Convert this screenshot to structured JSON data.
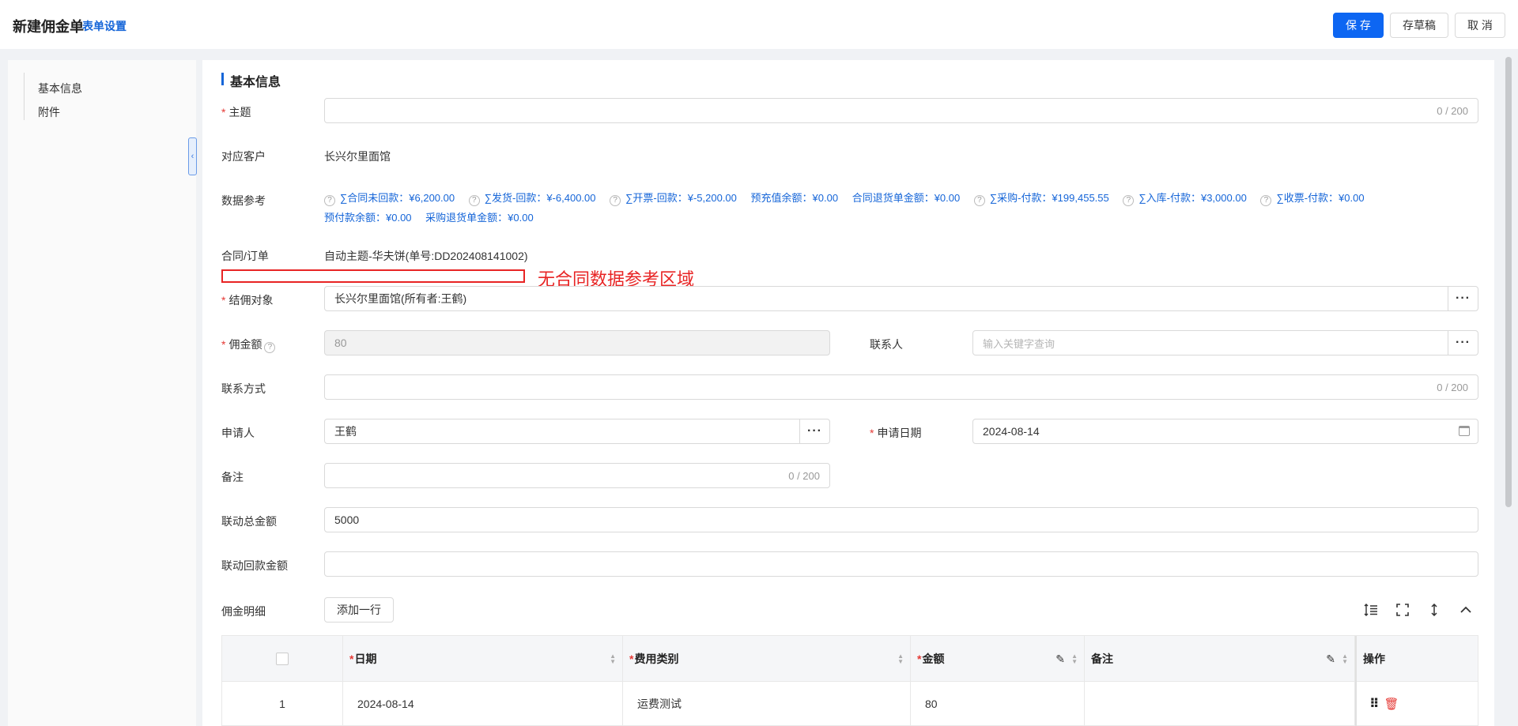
{
  "header": {
    "title": "新建佣金单",
    "form_settings": "表单设置",
    "buttons": {
      "save": "保 存",
      "draft": "存草稿",
      "cancel": "取 消"
    }
  },
  "sidebar": {
    "items": [
      {
        "label": "基本信息"
      },
      {
        "label": "附件"
      }
    ],
    "collapse_glyph": "‹"
  },
  "section": {
    "title": "基本信息"
  },
  "fields": {
    "subject": {
      "label": "主题",
      "required": "*",
      "value": "",
      "counter": "0 / 200"
    },
    "customer": {
      "label": "对应客户",
      "value": "长兴尔里面馆"
    },
    "data_ref": {
      "label": "数据参考"
    },
    "contract": {
      "label": "合同/订单",
      "value": "自动主题-华夫饼(单号:DD202408141002)"
    },
    "settlement": {
      "label": "结佣对象",
      "required": "*",
      "value": "长兴尔里面馆(所有者:王鹤)"
    },
    "commission": {
      "label": "佣金额",
      "required": "*",
      "value": "80"
    },
    "contact_person": {
      "label": "联系人",
      "placeholder": "输入关键字查询"
    },
    "contact_method": {
      "label": "联系方式",
      "value": "",
      "counter": "0 / 200"
    },
    "applicant": {
      "label": "申请人",
      "value": "王鹤"
    },
    "apply_date": {
      "label": "申请日期",
      "required": "*",
      "value": "2024-08-14"
    },
    "remark": {
      "label": "备注",
      "value": "",
      "counter": "0 / 200"
    },
    "linked_total": {
      "label": "联动总金额",
      "value": "5000"
    },
    "linked_returned": {
      "label": "联动回款金额",
      "value": ""
    },
    "detail": {
      "label": "佣金明细",
      "add_row": "添加一行"
    }
  },
  "data_refs": [
    {
      "text": "∑合同未回款：¥6,200.00",
      "help": true
    },
    {
      "text": "∑发货-回款：¥-6,400.00",
      "help": true
    },
    {
      "text": "∑开票-回款：¥-5,200.00",
      "help": true
    },
    {
      "text": "预充值余额：¥0.00",
      "help": false
    },
    {
      "text": "合同退货单金额：¥0.00",
      "help": false
    },
    {
      "text": "∑采购-付款：¥199,455.55",
      "help": true
    },
    {
      "text": "∑入库-付款：¥3,000.00",
      "help": true
    },
    {
      "text": "∑收票-付款：¥0.00",
      "help": true
    },
    {
      "text": "预付款余额：¥0.00",
      "help": false
    },
    {
      "text": "采购退货单金额：¥0.00",
      "help": false
    }
  ],
  "annotation": {
    "text": "无合同数据参考区域",
    "color": "#e82424"
  },
  "table": {
    "columns": [
      {
        "label": "日期",
        "required": "*"
      },
      {
        "label": "费用类别",
        "required": "*"
      },
      {
        "label": "金额",
        "required": "*"
      },
      {
        "label": "备注",
        "required": ""
      },
      {
        "label": "操作",
        "required": ""
      }
    ],
    "rows": [
      {
        "index": "1",
        "date": "2024-08-14",
        "category": "运费测试",
        "amount": "80",
        "remark": ""
      }
    ]
  },
  "colors": {
    "primary": "#0d66f2",
    "link": "#1565d8",
    "required": "#e53935"
  }
}
